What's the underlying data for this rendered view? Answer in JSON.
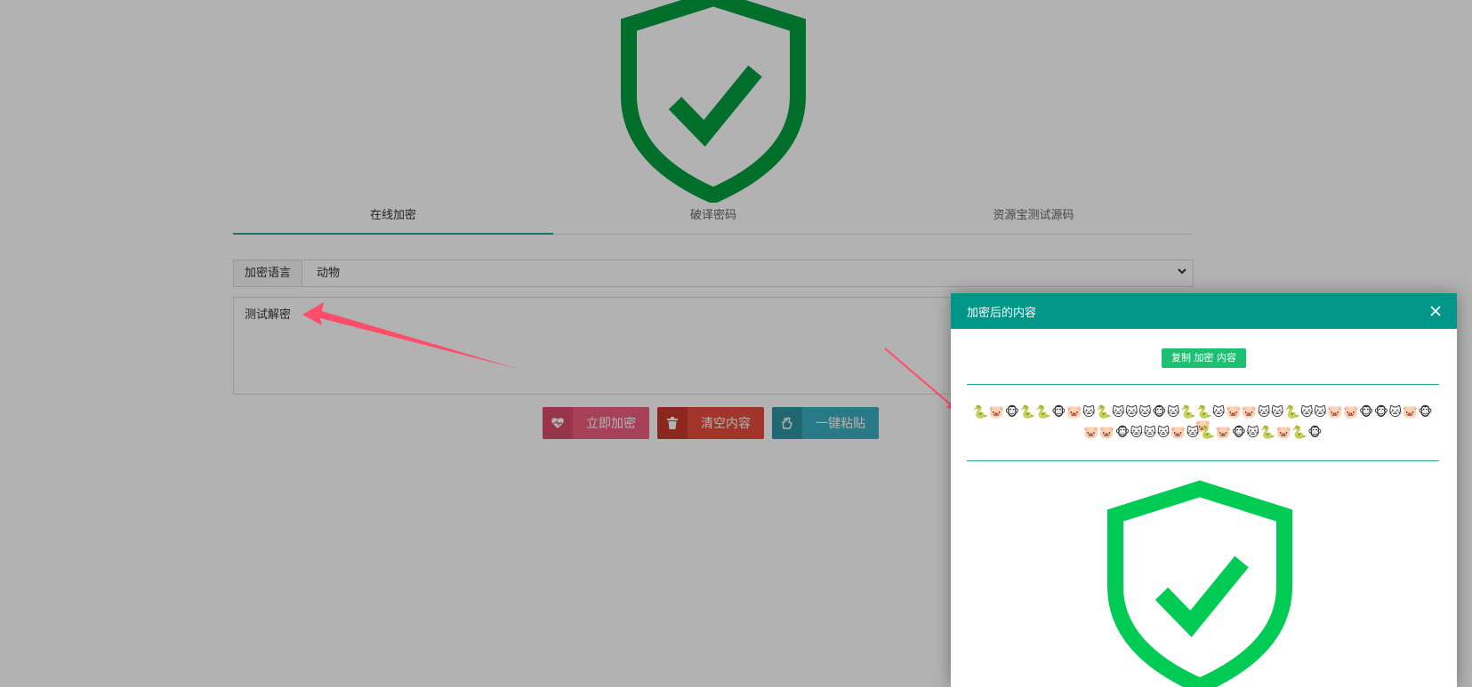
{
  "tabs": [
    {
      "label": "在线加密",
      "active": true
    },
    {
      "label": "破译密码",
      "active": false
    },
    {
      "label": "资源宝测试源码",
      "active": false
    }
  ],
  "form": {
    "language_label": "加密语言",
    "language_value": "动物",
    "input_text": "测试解密"
  },
  "buttons": {
    "encrypt": "立即加密",
    "clear": "清空内容",
    "paste": "一键粘贴"
  },
  "dialog": {
    "title": "加密后的内容",
    "copy_button": "复制 加密 内容",
    "encrypted_line1": "🐍🐷🐵🐍🐍🐵🐷🐱🐍🐱🐱🐱🐵🐱🐍🐍🐱🐷🐷🐱🐱🐍🐱🐱🐷🐷🐵🐵🐱🐷🐵🐷",
    "encrypted_line2": "🐷🐷🐵🐱🐱🐱🐷🐱🐍🐷🐵🐱🐍🐷🐍🐵"
  },
  "colors": {
    "shield_green": "#00a040",
    "dialog_shield_green": "#00cc55",
    "header_teal": "#009688",
    "arrow_red": "#ff4d6a"
  }
}
